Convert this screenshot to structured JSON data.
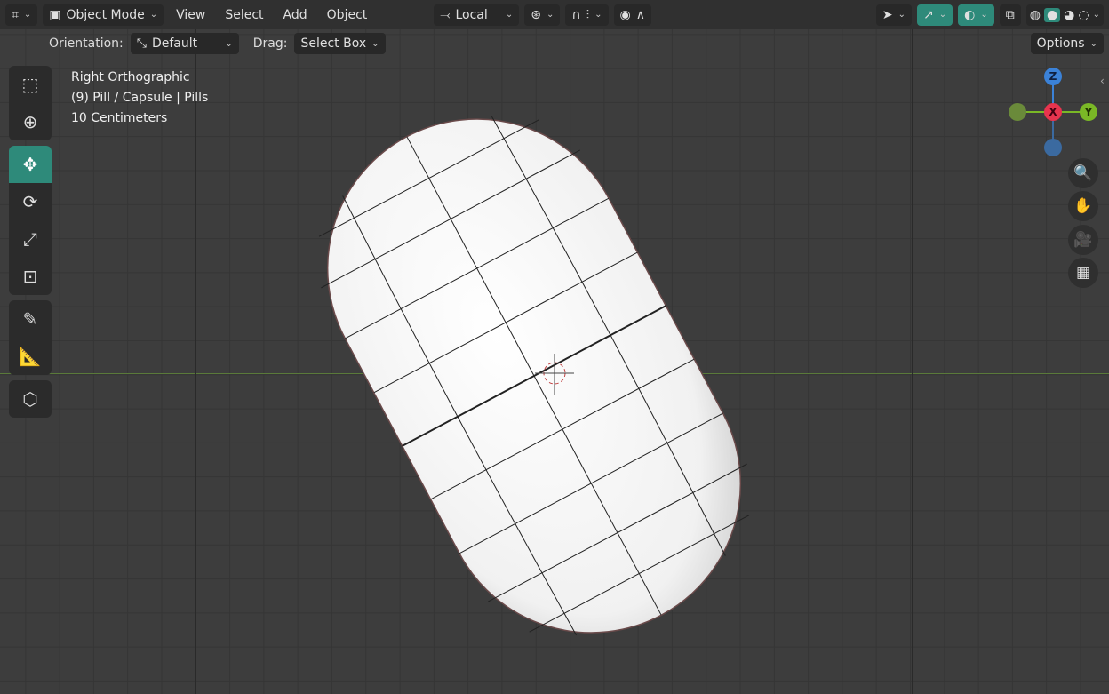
{
  "header": {
    "mode": "Object Mode",
    "menus": [
      "View",
      "Select",
      "Add",
      "Object"
    ],
    "transform_orientation": "Local",
    "shading_active": "solid"
  },
  "tool_header": {
    "orientation_label": "Orientation:",
    "orientation_value": "Default",
    "drag_label": "Drag:",
    "drag_value": "Select Box",
    "options": "Options"
  },
  "overlay": {
    "view_name": "Right Orthographic",
    "object": "(9) Pill / Capsule | Pills",
    "scale": "10 Centimeters"
  },
  "gizmo": {
    "z": "Z",
    "x": "X",
    "y": "Y"
  },
  "colors": {
    "accent": "#2e8a7a",
    "x_axis": "#e8344e",
    "y_axis": "#7ab826",
    "z_axis": "#3b82d8"
  }
}
